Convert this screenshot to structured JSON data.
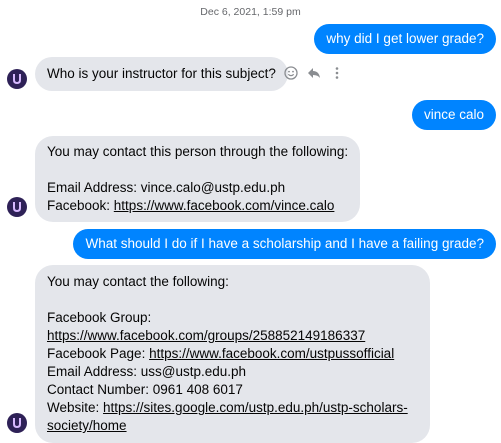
{
  "thread": {
    "timestamp": "Dec 6, 2021, 1:59 pm"
  },
  "messages": [
    {
      "from": "user",
      "text": "why did I get lower grade?"
    },
    {
      "from": "bot",
      "lines": [
        "Who is your instructor for this subject?"
      ]
    },
    {
      "from": "user",
      "text": "vince calo"
    },
    {
      "from": "bot",
      "lines": [
        "You may contact this person through the following:",
        "",
        "Email Address: vince.calo@ustp.edu.ph"
      ],
      "fb_label": "Facebook: ",
      "fb_link": "https://www.facebook.com/vince.calo"
    },
    {
      "from": "user",
      "text": "What should I do if I have a scholarship and I have a failing grade?"
    },
    {
      "from": "bot",
      "intro": "You may contact the following:",
      "group_label": "Facebook Group:",
      "group_link": "https://www.facebook.com/groups/258852149186337",
      "page_label": "Facebook Page: ",
      "page_link": "https://www.facebook.com/ustpussofficial",
      "email": "Email Address: uss@ustp.edu.ph",
      "contact": "Contact Number: 0961 408 6017",
      "website_label": "Website: ",
      "website_link_1": "https://sites.google.com/ustp.edu.ph/ustp-scholars-",
      "website_link_2": "society/home"
    }
  ],
  "icons": {
    "avatar": "bot-avatar-icon",
    "react": "smiley-react-icon",
    "reply": "reply-arrow-icon",
    "more": "more-vertical-icon"
  },
  "colors": {
    "outgoing": "#0084ff",
    "incoming": "#e4e6eb",
    "avatar_bg": "#2e2157",
    "avatar_fg": "#d7b8ff"
  }
}
